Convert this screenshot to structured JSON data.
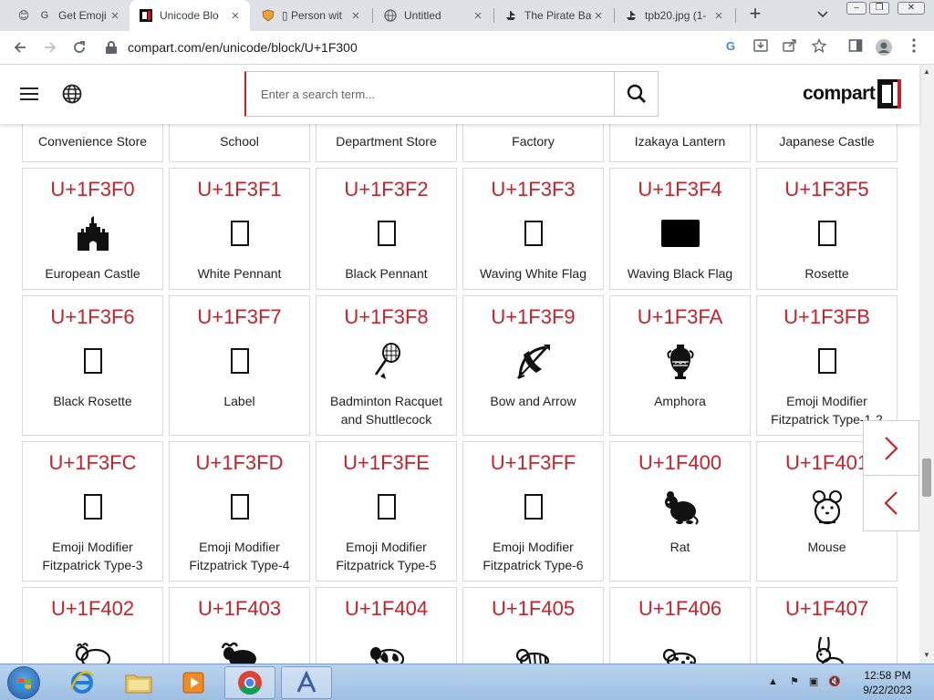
{
  "browser": {
    "tabs": [
      {
        "title": "Get Emoji",
        "favicon": "emoji-face-icon"
      },
      {
        "title": "Unicode Blo",
        "favicon": "compart-icon",
        "active": true
      },
      {
        "title": "▯ Person wit",
        "favicon": "shield-icon"
      },
      {
        "title": "Untitled",
        "favicon": "globe-icon"
      },
      {
        "title": "The Pirate Ba",
        "favicon": "ship-icon"
      },
      {
        "title": "tpb20.jpg (1-",
        "favicon": "ship-icon"
      }
    ],
    "new_tab": "+",
    "url": "compart.com/en/unicode/block/U+1F300"
  },
  "site": {
    "search_placeholder": "Enter a search term...",
    "logo_text": "compart"
  },
  "grid": {
    "top_row_names": [
      "Convenience Store",
      "School",
      "Department Store",
      "Factory",
      "Izakaya Lantern",
      "Japanese Castle"
    ],
    "cards": [
      {
        "code": "U+1F3F0",
        "name": "European Castle",
        "icon": "castle-icon"
      },
      {
        "code": "U+1F3F1",
        "name": "White Pennant",
        "icon": "missing-glyph-box"
      },
      {
        "code": "U+1F3F2",
        "name": "Black Pennant",
        "icon": "missing-glyph-box"
      },
      {
        "code": "U+1F3F3",
        "name": "Waving White Flag",
        "icon": "missing-glyph-box"
      },
      {
        "code": "U+1F3F4",
        "name": "Waving Black Flag",
        "icon": "black-flag-icon"
      },
      {
        "code": "U+1F3F5",
        "name": "Rosette",
        "icon": "missing-glyph-box"
      },
      {
        "code": "U+1F3F6",
        "name": "Black Rosette",
        "icon": "missing-glyph-box"
      },
      {
        "code": "U+1F3F7",
        "name": "Label",
        "icon": "missing-glyph-box"
      },
      {
        "code": "U+1F3F8",
        "name": "Badminton Racquet and Shuttlecock",
        "icon": "badminton-icon"
      },
      {
        "code": "U+1F3F9",
        "name": "Bow and Arrow",
        "icon": "bow-arrow-icon"
      },
      {
        "code": "U+1F3FA",
        "name": "Amphora",
        "icon": "amphora-icon"
      },
      {
        "code": "U+1F3FB",
        "name": "Emoji Modifier Fitzpatrick Type-1-2",
        "icon": "missing-glyph-box"
      },
      {
        "code": "U+1F3FC",
        "name": "Emoji Modifier Fitzpatrick Type-3",
        "icon": "missing-glyph-box"
      },
      {
        "code": "U+1F3FD",
        "name": "Emoji Modifier Fitzpatrick Type-4",
        "icon": "missing-glyph-box"
      },
      {
        "code": "U+1F3FE",
        "name": "Emoji Modifier Fitzpatrick Type-5",
        "icon": "missing-glyph-box"
      },
      {
        "code": "U+1F3FF",
        "name": "Emoji Modifier Fitzpatrick Type-6",
        "icon": "missing-glyph-box"
      },
      {
        "code": "U+1F400",
        "name": "Rat",
        "icon": "rat-icon"
      },
      {
        "code": "U+1F401",
        "name": "Mouse",
        "icon": "mouse-icon"
      },
      {
        "code": "U+1F402",
        "name": "",
        "icon": "ox-icon"
      },
      {
        "code": "U+1F403",
        "name": "",
        "icon": "water-buffalo-icon"
      },
      {
        "code": "U+1F404",
        "name": "",
        "icon": "cow-icon"
      },
      {
        "code": "U+1F405",
        "name": "",
        "icon": "tiger-icon"
      },
      {
        "code": "U+1F406",
        "name": "",
        "icon": "leopard-icon"
      },
      {
        "code": "U+1F407",
        "name": "",
        "icon": "rabbit-icon"
      }
    ]
  },
  "taskbar": {
    "time": "12:58 PM",
    "date": "9/22/2023"
  },
  "colors": {
    "accent": "#c6222b",
    "tab_strip": "#dee1e6"
  }
}
